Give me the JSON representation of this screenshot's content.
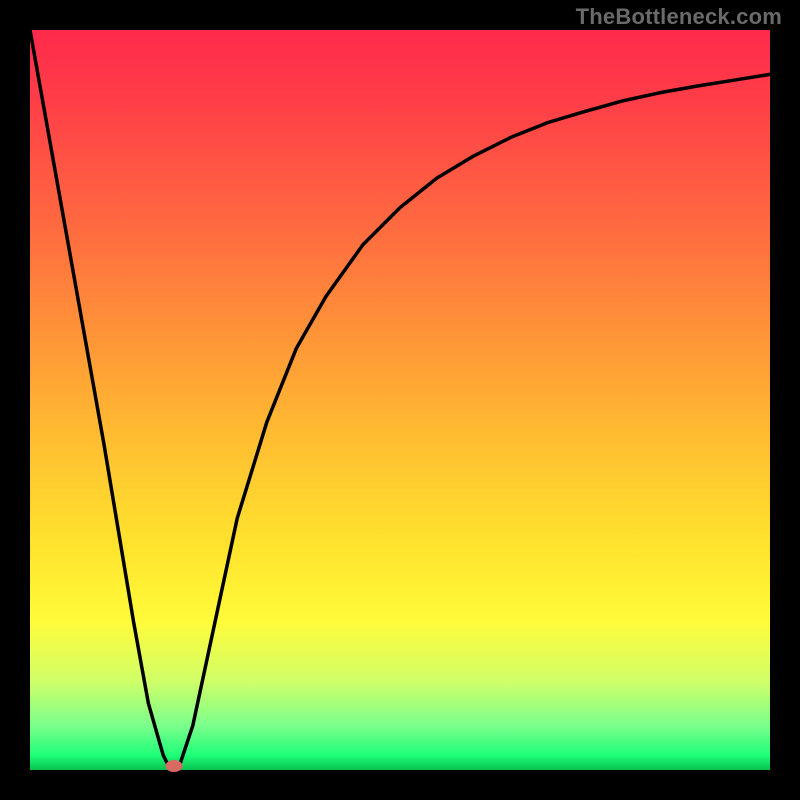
{
  "watermark": "TheBottleneck.com",
  "colors": {
    "frame_bg": "#000000",
    "curve": "#000000",
    "marker": "#d86a63",
    "gradient_top": "#ff2a4b",
    "gradient_bottom": "#07c24d"
  },
  "chart_data": {
    "type": "line",
    "title": "",
    "xlabel": "",
    "ylabel": "",
    "xlim": [
      0,
      100
    ],
    "ylim": [
      0,
      100
    ],
    "grid": false,
    "legend": false,
    "series": [
      {
        "name": "bottleneck-curve",
        "x": [
          0,
          5,
          10,
          14,
          16,
          18,
          19,
          20,
          22,
          25,
          28,
          32,
          36,
          40,
          45,
          50,
          55,
          60,
          65,
          70,
          75,
          80,
          85,
          90,
          95,
          100
        ],
        "y": [
          100,
          72,
          44,
          20,
          9,
          2,
          0,
          0,
          6,
          20,
          34,
          47,
          57,
          64,
          71,
          76,
          80,
          83,
          85.5,
          87.5,
          89,
          90.4,
          91.5,
          92.4,
          93.2,
          94
        ]
      }
    ],
    "marker_point": {
      "x": 19.5,
      "y": 0.5
    },
    "gradient_stops": [
      {
        "pos": 0,
        "color": "#ff2a4b"
      },
      {
        "pos": 10,
        "color": "#ff3f48"
      },
      {
        "pos": 28,
        "color": "#ff6e3f"
      },
      {
        "pos": 44,
        "color": "#ff9c36"
      },
      {
        "pos": 58,
        "color": "#ffc530"
      },
      {
        "pos": 70,
        "color": "#ffe42d"
      },
      {
        "pos": 80,
        "color": "#fffb3a"
      },
      {
        "pos": 88,
        "color": "#d0ff68"
      },
      {
        "pos": 94,
        "color": "#7aff8c"
      },
      {
        "pos": 98,
        "color": "#1fff79"
      },
      {
        "pos": 100,
        "color": "#07c24d"
      }
    ]
  }
}
